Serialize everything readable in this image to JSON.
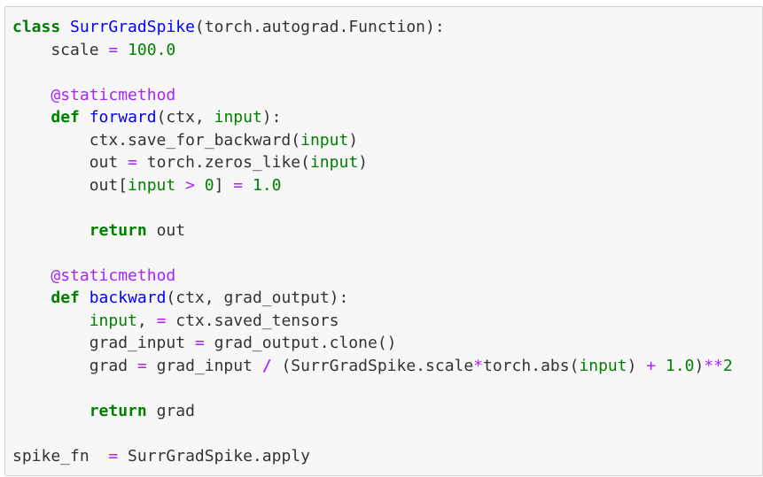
{
  "lines": [
    [
      {
        "t": "class",
        "c": "kw"
      },
      {
        "t": " ",
        "c": ""
      },
      {
        "t": "SurrGradSpike",
        "c": "cls"
      },
      {
        "t": "(torch.autograd.Function):",
        "c": ""
      }
    ],
    [
      {
        "t": "    scale ",
        "c": ""
      },
      {
        "t": "=",
        "c": "op"
      },
      {
        "t": " ",
        "c": ""
      },
      {
        "t": "100.0",
        "c": "num"
      }
    ],
    [],
    [
      {
        "t": "    ",
        "c": ""
      },
      {
        "t": "@staticmethod",
        "c": "deco"
      }
    ],
    [
      {
        "t": "    ",
        "c": ""
      },
      {
        "t": "def",
        "c": "kw"
      },
      {
        "t": " ",
        "c": ""
      },
      {
        "t": "forward",
        "c": "fn"
      },
      {
        "t": "(ctx, ",
        "c": ""
      },
      {
        "t": "input",
        "c": "bi"
      },
      {
        "t": "):",
        "c": ""
      }
    ],
    [
      {
        "t": "        ctx.save_for_backward(",
        "c": ""
      },
      {
        "t": "input",
        "c": "bi"
      },
      {
        "t": ")",
        "c": ""
      }
    ],
    [
      {
        "t": "        out ",
        "c": ""
      },
      {
        "t": "=",
        "c": "op"
      },
      {
        "t": " torch.zeros_like(",
        "c": ""
      },
      {
        "t": "input",
        "c": "bi"
      },
      {
        "t": ")",
        "c": ""
      }
    ],
    [
      {
        "t": "        out[",
        "c": ""
      },
      {
        "t": "input",
        "c": "bi"
      },
      {
        "t": " ",
        "c": ""
      },
      {
        "t": ">",
        "c": "op"
      },
      {
        "t": " ",
        "c": ""
      },
      {
        "t": "0",
        "c": "num"
      },
      {
        "t": "] ",
        "c": ""
      },
      {
        "t": "=",
        "c": "op"
      },
      {
        "t": " ",
        "c": ""
      },
      {
        "t": "1.0",
        "c": "num"
      }
    ],
    [],
    [
      {
        "t": "        ",
        "c": ""
      },
      {
        "t": "return",
        "c": "kw"
      },
      {
        "t": " out",
        "c": ""
      }
    ],
    [],
    [
      {
        "t": "    ",
        "c": ""
      },
      {
        "t": "@staticmethod",
        "c": "deco"
      }
    ],
    [
      {
        "t": "    ",
        "c": ""
      },
      {
        "t": "def",
        "c": "kw"
      },
      {
        "t": " ",
        "c": ""
      },
      {
        "t": "backward",
        "c": "fn"
      },
      {
        "t": "(ctx, grad_output):",
        "c": ""
      }
    ],
    [
      {
        "t": "        ",
        "c": ""
      },
      {
        "t": "input",
        "c": "bi"
      },
      {
        "t": ", ",
        "c": ""
      },
      {
        "t": "=",
        "c": "op"
      },
      {
        "t": " ctx.saved_tensors",
        "c": ""
      }
    ],
    [
      {
        "t": "        grad_input ",
        "c": ""
      },
      {
        "t": "=",
        "c": "op"
      },
      {
        "t": " grad_output.clone()",
        "c": ""
      }
    ],
    [
      {
        "t": "        grad ",
        "c": ""
      },
      {
        "t": "=",
        "c": "op"
      },
      {
        "t": " grad_input ",
        "c": ""
      },
      {
        "t": "/",
        "c": "opb"
      },
      {
        "t": " (SurrGradSpike.scale",
        "c": ""
      },
      {
        "t": "*",
        "c": "op"
      },
      {
        "t": "torch.abs(",
        "c": ""
      },
      {
        "t": "input",
        "c": "bi"
      },
      {
        "t": ") ",
        "c": ""
      },
      {
        "t": "+",
        "c": "op"
      },
      {
        "t": " ",
        "c": ""
      },
      {
        "t": "1.0",
        "c": "num"
      },
      {
        "t": ")",
        "c": ""
      },
      {
        "t": "**",
        "c": "op"
      },
      {
        "t": "2",
        "c": "num"
      }
    ],
    [],
    [
      {
        "t": "        ",
        "c": ""
      },
      {
        "t": "return",
        "c": "kw"
      },
      {
        "t": " grad",
        "c": ""
      }
    ],
    [],
    [
      {
        "t": "spike_fn  ",
        "c": ""
      },
      {
        "t": "=",
        "c": "op"
      },
      {
        "t": " SurrGradSpike.apply",
        "c": ""
      }
    ]
  ]
}
